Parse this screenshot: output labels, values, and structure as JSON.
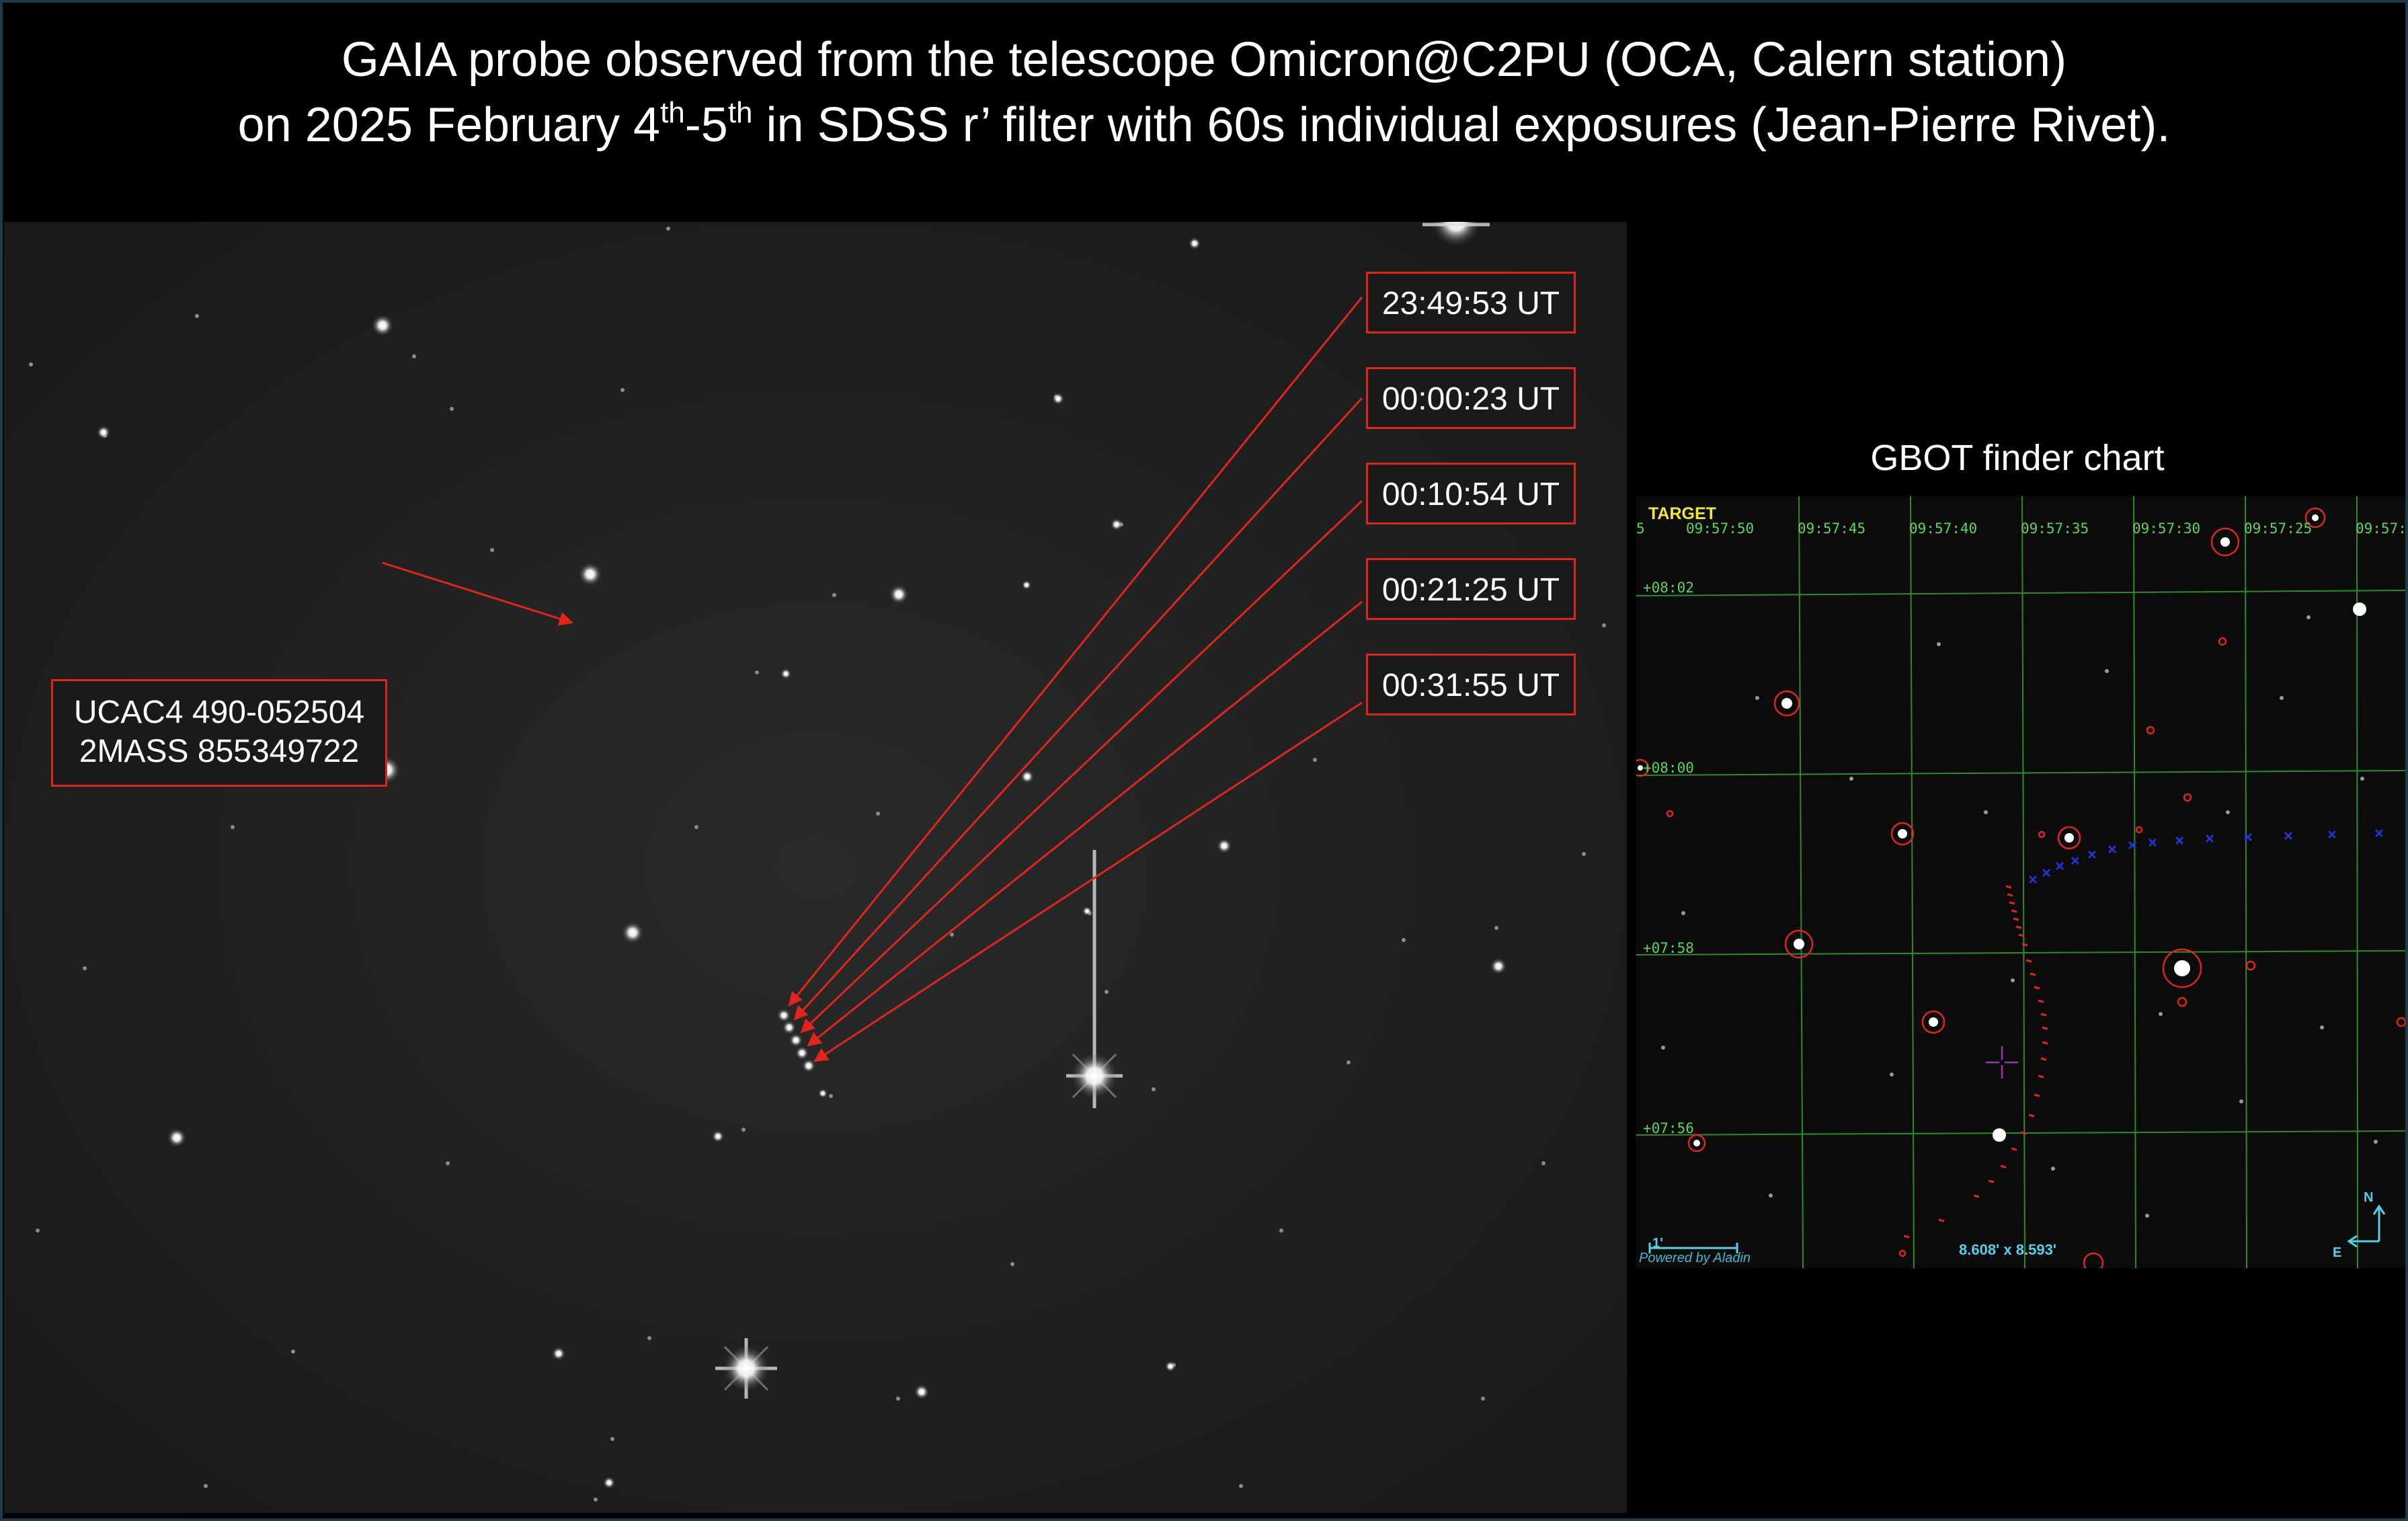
{
  "header": {
    "line1": "GAIA probe observed from the telescope Omicron@C2PU (OCA, Calern station)",
    "line2_a": "on 2025 February 4",
    "line2_sup1": "th",
    "line2_b": "-5",
    "line2_sup2": "th",
    "line2_c": " in SDSS r’ filter with 60s individual exposures (Jean-Pierre Rivet)."
  },
  "main_image": {
    "star_label": {
      "line1": "UCAC4 490-052504",
      "line2": "2MASS 855349722"
    },
    "timestamps": [
      "23:49:53 UT",
      "00:00:23 UT",
      "00:10:54 UT",
      "00:21:25 UT",
      "00:31:55 UT"
    ]
  },
  "finder": {
    "title": "GBOT finder chart",
    "target_label": "TARGET",
    "ra_ticks": [
      "5",
      "09:57:50",
      "09:57:45",
      "09:57:40",
      "09:57:35",
      "09:57:30",
      "09:57:25",
      "09:57:2"
    ],
    "dec_ticks": [
      "+08:02",
      "+08:00",
      "+07:58",
      "+07:56"
    ],
    "scale_label": "1'",
    "powered_by": "Powered by Aladin",
    "field_size": "8.608' x 8.593'",
    "north_label": "N",
    "east_label": "E"
  },
  "colors": {
    "annotation_red": "#e0261c",
    "grid_green": "#2f8a2f",
    "tick_green": "#5cd65c",
    "target_yellow": "#f5e63a",
    "trajectory_blue": "#2233cc",
    "compass_cyan": "#55d0e8",
    "crosshair_magenta": "#9b3aa8"
  }
}
